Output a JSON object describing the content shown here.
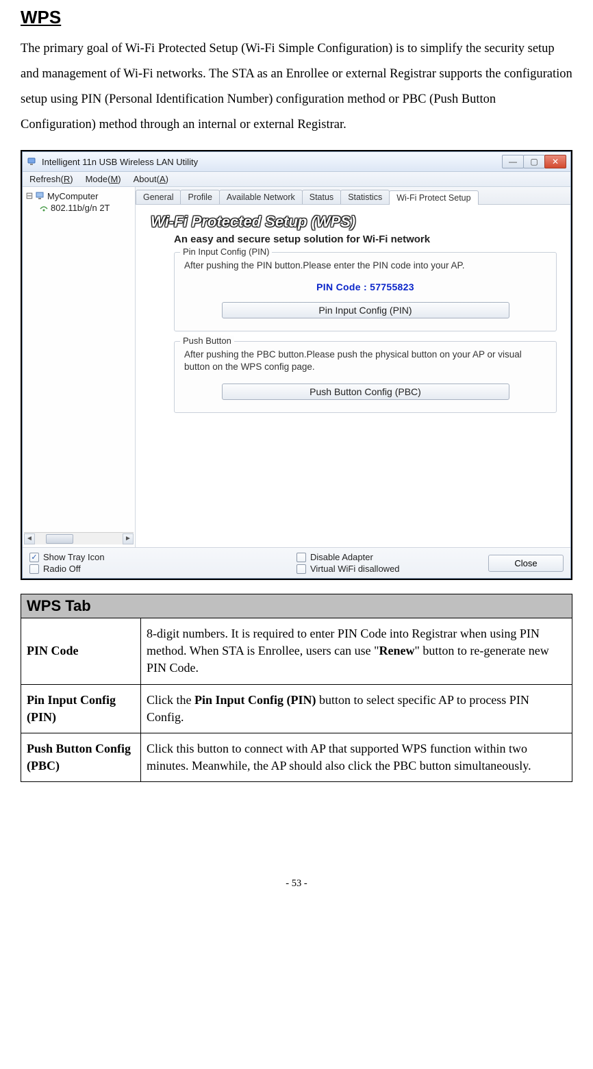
{
  "heading": "WPS",
  "intro": "The primary goal of Wi-Fi Protected Setup (Wi-Fi Simple Configuration) is to simplify the security setup and management of Wi-Fi networks. The STA as an Enrollee or external Registrar supports the configuration setup using PIN (Personal Identification Number) configuration method or PBC (Push Button Configuration) method through an internal or external Registrar.",
  "window": {
    "title": "Intelligent 11n USB Wireless LAN Utility",
    "menu": {
      "refresh": "Refresh(R)",
      "mode": "Mode(M)",
      "about": "About(A)"
    },
    "tree": {
      "node1": "MyComputer",
      "node2": "802.11b/g/n 2T"
    },
    "tabs": {
      "general": "General",
      "profile": "Profile",
      "available": "Available Network",
      "status": "Status",
      "statistics": "Statistics",
      "wps": "Wi-Fi Protect Setup"
    },
    "wps": {
      "title": "Wi-Fi Protected Setup (WPS)",
      "subtitle": "An easy and secure setup solution for Wi-Fi network",
      "pin": {
        "legend": "Pin Input Config (PIN)",
        "text": "After pushing the PIN button.Please enter the PIN code into your AP.",
        "code_label": "PIN Code :  57755823",
        "button": "Pin Input Config (PIN)"
      },
      "pbc": {
        "legend": "Push Button",
        "text": "After pushing the PBC button.Please push the physical button on your AP or visual button on the WPS config page.",
        "button": "Push Button Config (PBC)"
      }
    },
    "footer": {
      "show_tray": "Show Tray Icon",
      "radio_off": "Radio Off",
      "disable_adapter": "Disable Adapter",
      "virtual_wifi": "Virtual WiFi disallowed",
      "close": "Close"
    }
  },
  "table": {
    "header": "WPS Tab",
    "rows": {
      "pin_code": {
        "label": "PIN Code",
        "val_pre": "8-digit numbers. It is required to enter PIN Code into Registrar when using PIN method. When STA is Enrollee, users can use \"",
        "val_bold": "Renew",
        "val_post": "\" button to re-generate new PIN Code."
      },
      "pin_input": {
        "label": "Pin Input Config (PIN)",
        "val_pre": "Click the ",
        "val_bold": "Pin Input Config (PIN)",
        "val_post": " button to select specific AP to process PIN Config."
      },
      "pbc": {
        "label": "Push Button Config (PBC)",
        "val": "Click this button to connect with AP that supported WPS function within two minutes. Meanwhile, the AP should also click the PBC button simultaneously."
      }
    }
  },
  "page_number": "- 53 -"
}
